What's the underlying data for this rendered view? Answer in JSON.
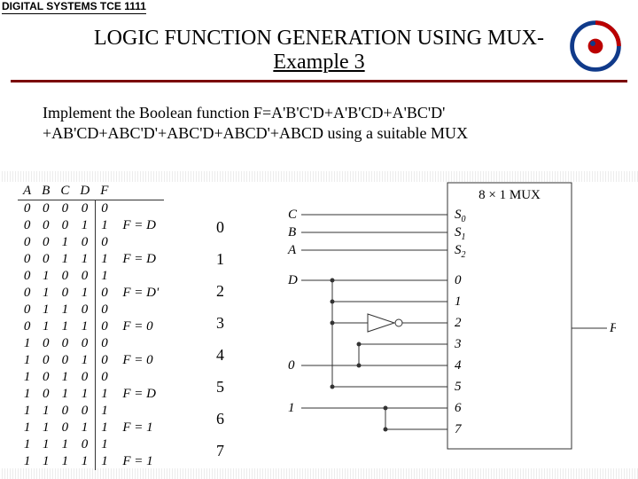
{
  "course_code": "DIGITAL SYSTEMS TCE 1111",
  "title_line1": "LOGIC FUNCTION GENERATION USING MUX-",
  "title_line2": "Example 3",
  "task_text": "Implement the Boolean function F=A'B'C'D+A'B'CD+A'BC'D' +AB'CD+ABC'D'+ABC'D+ABCD'+ABCD using a suitable MUX",
  "truth": {
    "headers": [
      "A",
      "B",
      "C",
      "D",
      "F",
      ""
    ],
    "rows": [
      [
        "0",
        "0",
        "0",
        "0",
        "0",
        ""
      ],
      [
        "0",
        "0",
        "0",
        "1",
        "1",
        "F = D"
      ],
      [
        "0",
        "0",
        "1",
        "0",
        "0",
        ""
      ],
      [
        "0",
        "0",
        "1",
        "1",
        "1",
        "F = D"
      ],
      [
        "0",
        "1",
        "0",
        "0",
        "1",
        ""
      ],
      [
        "0",
        "1",
        "0",
        "1",
        "0",
        "F = D'"
      ],
      [
        "0",
        "1",
        "1",
        "0",
        "0",
        ""
      ],
      [
        "0",
        "1",
        "1",
        "1",
        "0",
        "F = 0"
      ],
      [
        "1",
        "0",
        "0",
        "0",
        "0",
        ""
      ],
      [
        "1",
        "0",
        "0",
        "1",
        "0",
        "F = 0"
      ],
      [
        "1",
        "0",
        "1",
        "0",
        "0",
        ""
      ],
      [
        "1",
        "0",
        "1",
        "1",
        "1",
        "F = D"
      ],
      [
        "1",
        "1",
        "0",
        "0",
        "1",
        ""
      ],
      [
        "1",
        "1",
        "0",
        "1",
        "1",
        "F = 1"
      ],
      [
        "1",
        "1",
        "1",
        "0",
        "1",
        ""
      ],
      [
        "1",
        "1",
        "1",
        "1",
        "1",
        "F = 1"
      ]
    ]
  },
  "group_idx": [
    "0",
    "1",
    "2",
    "3",
    "4",
    "5",
    "6",
    "7"
  ],
  "mux": {
    "title": "8 × 1 MUX",
    "sel": [
      {
        "sig": "C",
        "pin": "S",
        "sub": "0"
      },
      {
        "sig": "B",
        "pin": "S",
        "sub": "1"
      },
      {
        "sig": "A",
        "pin": "S",
        "sub": "2"
      }
    ],
    "data_label": "D",
    "zero_label": "0",
    "one_label": "1",
    "inputs": [
      "0",
      "1",
      "2",
      "3",
      "4",
      "5",
      "6",
      "7"
    ],
    "output": "F"
  }
}
